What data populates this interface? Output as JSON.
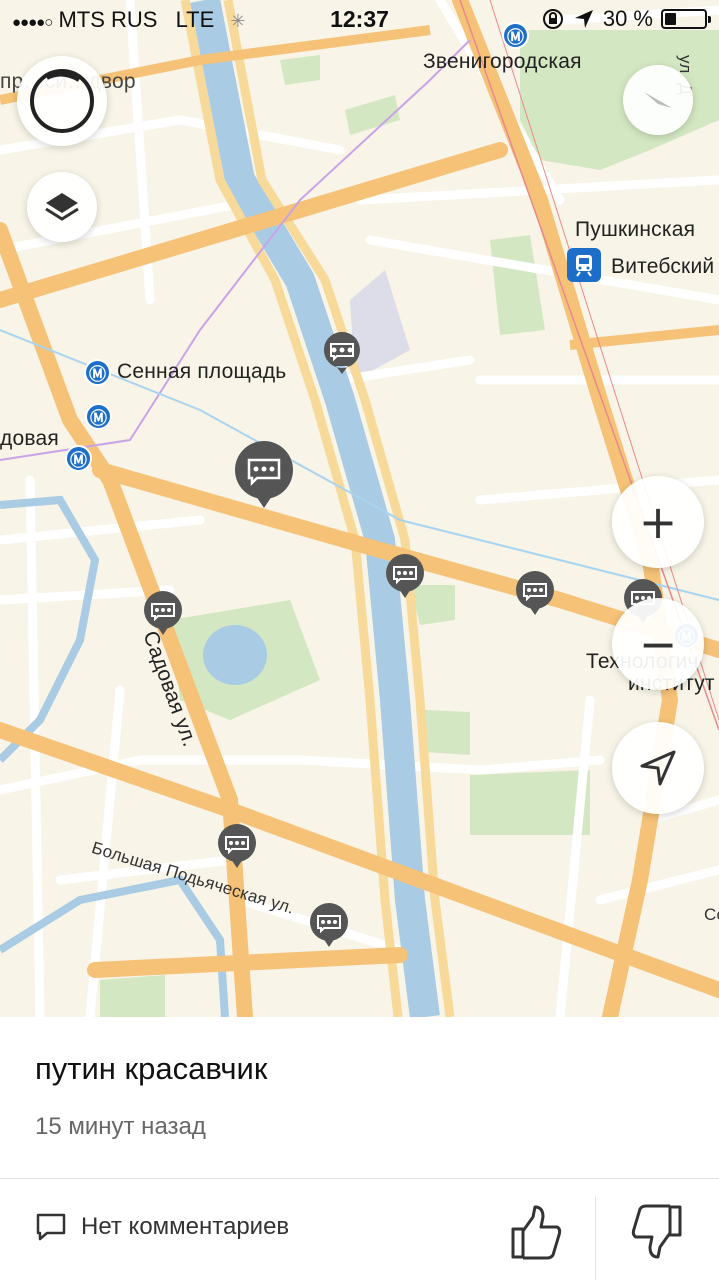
{
  "status_bar": {
    "signal": "●●●●○",
    "carrier": "MTS RUS",
    "network": "LTE",
    "time": "12:37",
    "battery": "30 %",
    "battery_level": 0.3
  },
  "map": {
    "labels": {
      "dvor": "пр…си…двор",
      "zvenigorodskaya": "Звенигородская",
      "ul_dostoevskogo": "ул. Д",
      "pushkinskaya": "Пушкинская",
      "vitebsky": "Витебский",
      "sennaya": "Сенная площадь",
      "sadovaya_station": "довая",
      "sadovaya_street": "Садовая ул.",
      "podyacheskaya": "Большая Подьяческая ул.",
      "tekhnolog": "Технологич",
      "institut": "институт",
      "so": "Со"
    },
    "metro_symbol": "Ⓜ",
    "colors": {
      "land": "#f8f4e7",
      "main_road": "#f5c277",
      "street": "#ffffff",
      "water": "#a9cbe3",
      "park": "#d3e8c2",
      "metro": "#1d6ec8",
      "marker": "#555555"
    }
  },
  "controls": {
    "compass_icon": "compass-icon",
    "layers_icon": "layers-icon",
    "zoom_in": "+",
    "zoom_out": "−",
    "locate_icon": "locate-icon"
  },
  "post": {
    "text": "путин красавчик",
    "time": "15 минут назад",
    "comments_label": "Нет комментариев"
  }
}
